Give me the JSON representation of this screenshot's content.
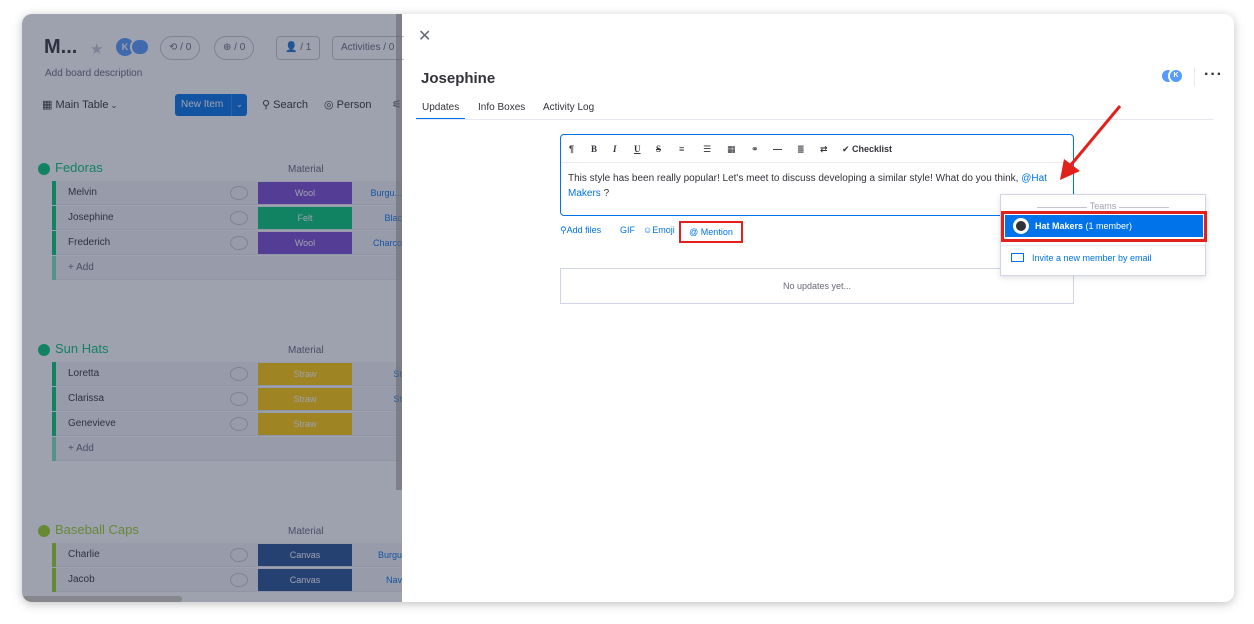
{
  "board": {
    "title": "M...",
    "avatar": "K",
    "pill_updates": "⟲ / 0",
    "pill_integrations": "⊕ / 0",
    "pill_members": "👤 / 1",
    "activities": "Activities / 0",
    "description": "Add board description",
    "toolbar": {
      "view": "Main Table",
      "new_item": "New Item",
      "search": "Search",
      "person": "Person",
      "filter": "F"
    },
    "groups": [
      {
        "name": "Fedoras",
        "color": "#00c875",
        "column": "Material",
        "rows": [
          {
            "name": "Melvin",
            "material": "Wool",
            "color": "#784bd1",
            "extra": "Burgu..."
          },
          {
            "name": "Josephine",
            "material": "Felt",
            "color": "#00c875",
            "extra": "Blac"
          },
          {
            "name": "Frederich",
            "material": "Wool",
            "color": "#784bd1",
            "extra": "Charco"
          }
        ],
        "add": "+ Add"
      },
      {
        "name": "Sun Hats",
        "color": "#00c875",
        "column": "Material",
        "rows": [
          {
            "name": "Loretta",
            "material": "Straw",
            "color": "#ffcb00",
            "extra": "St"
          },
          {
            "name": "Clarissa",
            "material": "Straw",
            "color": "#ffcb00",
            "extra": "St"
          },
          {
            "name": "Genevieve",
            "material": "Straw",
            "color": "#ffcb00",
            "extra": ""
          }
        ],
        "add": "+ Add"
      },
      {
        "name": "Baseball Caps",
        "color": "#9cd326",
        "column": "Material",
        "rows": [
          {
            "name": "Charlie",
            "material": "Canvas",
            "color": "#225091",
            "extra": "Burgu"
          },
          {
            "name": "Jacob",
            "material": "Canvas",
            "color": "#225091",
            "extra": "Nav"
          }
        ]
      }
    ]
  },
  "panel": {
    "item_name": "Josephine",
    "avatar": "K",
    "tabs": [
      "Updates",
      "Info Boxes",
      "Activity Log"
    ],
    "format_buttons": [
      "¶",
      "B",
      "I",
      "U",
      "S",
      "≡",
      "☰",
      "▦",
      "⚭",
      "—",
      "≣",
      "⇄",
      "✔ Checklist"
    ],
    "editor_text": "This style has been really popular! Let's meet to discuss developing a similar style! What do you think, ",
    "mention_text": "@Hat Makers",
    "editor_suffix": " ?",
    "actions": {
      "add_files": "Add files",
      "gif": "GIF",
      "emoji": "Emoji",
      "mention": "@ Mention"
    },
    "no_updates": "No updates yet...",
    "dropdown": {
      "header": "Teams",
      "team_name": "Hat Makers",
      "team_count": "(1 member)",
      "invite": "Invite a new member by email"
    }
  },
  "colors": {
    "primary": "#0073ea",
    "highlight_red": "#e2201c"
  }
}
